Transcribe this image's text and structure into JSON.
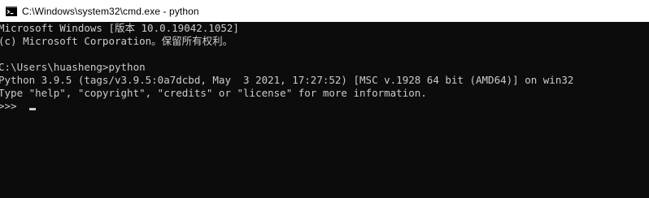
{
  "window": {
    "title": "C:\\Windows\\system32\\cmd.exe - python",
    "icon": "cmd-icon"
  },
  "console": {
    "lines": [
      "Microsoft Windows [版本 10.0.19042.1052]",
      "(c) Microsoft Corporation。保留所有权利。",
      "",
      "C:\\Users\\huasheng>python",
      "Python 3.9.5 (tags/v3.9.5:0a7dcbd, May  3 2021, 17:27:52) [MSC v.1928 64 bit (AMD64)] on win32",
      "Type \"help\", \"copyright\", \"credits\" or \"license\" for more information.",
      ">>> "
    ]
  },
  "colors": {
    "console_background": "#0c0c0c",
    "console_text": "#cccccc",
    "titlebar_background": "#ffffff"
  }
}
